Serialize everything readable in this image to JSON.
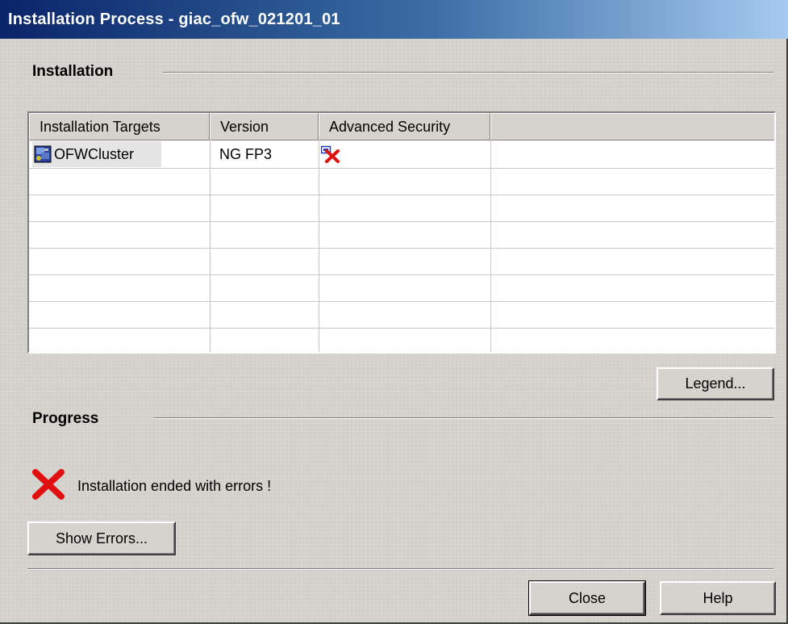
{
  "window": {
    "title": "Installation Process  - giac_ofw_021201_01"
  },
  "installation": {
    "section_label": "Installation",
    "columns": [
      "Installation Targets",
      "Version",
      "Advanced Security",
      ""
    ],
    "rows": [
      {
        "target": "OFWCluster",
        "version": "NG FP3",
        "advanced_security_icon": "module-error-icon"
      }
    ],
    "legend_button": "Legend..."
  },
  "progress": {
    "section_label": "Progress",
    "status_icon": "error-x-icon",
    "status_text": "Installation ended with errors !",
    "show_errors_button": "Show Errors..."
  },
  "footer": {
    "close_button": "Close",
    "help_button": "Help"
  },
  "colors": {
    "title_gradient_start": "#0a246a",
    "title_gradient_end": "#a6caf0",
    "dialog_bg": "#d6d3ce",
    "error_red": "#e01010"
  }
}
